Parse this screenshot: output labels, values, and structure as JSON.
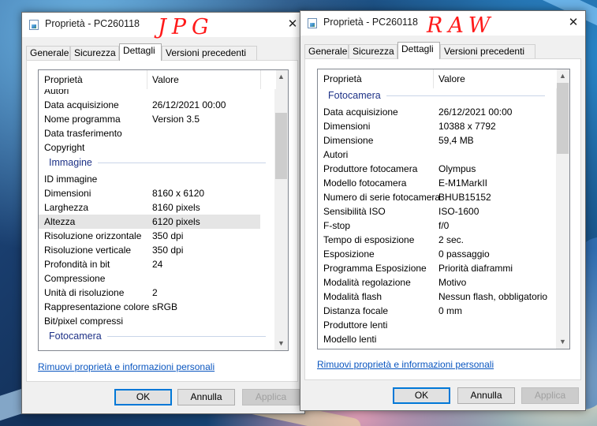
{
  "tabs": [
    "Generale",
    "Sicurezza",
    "Dettagli",
    "Versioni precedenti"
  ],
  "columns": {
    "property": "Proprietà",
    "value": "Valore"
  },
  "buttons": {
    "ok": "OK",
    "cancel": "Annulla",
    "apply": "Applica"
  },
  "remove_link": "Rimuovi proprietà e informazioni personali",
  "left": {
    "title": "Proprietà - PC260118",
    "annotation": "JPG",
    "rows": [
      {
        "prop": "Autori",
        "val": ""
      },
      {
        "prop": "Data acquisizione",
        "val": "26/12/2021 00:00"
      },
      {
        "prop": "Nome programma",
        "val": "Version 3.5"
      },
      {
        "prop": "Data trasferimento",
        "val": ""
      },
      {
        "prop": "Copyright",
        "val": ""
      },
      {
        "group": "Immagine"
      },
      {
        "prop": "ID immagine",
        "val": ""
      },
      {
        "prop": "Dimensioni",
        "val": "8160 x 6120"
      },
      {
        "prop": "Larghezza",
        "val": "8160 pixels"
      },
      {
        "prop": "Altezza",
        "val": "6120 pixels",
        "selected": true
      },
      {
        "prop": "Risoluzione orizzontale",
        "val": "350 dpi"
      },
      {
        "prop": "Risoluzione verticale",
        "val": "350 dpi"
      },
      {
        "prop": "Profondità in bit",
        "val": "24"
      },
      {
        "prop": "Compressione",
        "val": ""
      },
      {
        "prop": "Unità di risoluzione",
        "val": "2"
      },
      {
        "prop": "Rappresentazione colore",
        "val": "sRGB"
      },
      {
        "prop": "Bit/pixel compressi",
        "val": ""
      },
      {
        "group": "Fotocamera"
      }
    ]
  },
  "right": {
    "title": "Proprietà - PC260118",
    "annotation": "RAW",
    "rows": [
      {
        "group": "Fotocamera"
      },
      {
        "prop": "Data acquisizione",
        "val": "26/12/2021 00:00"
      },
      {
        "prop": "Dimensioni",
        "val": "10388 x 7792"
      },
      {
        "prop": "Dimensione",
        "val": "59,4 MB"
      },
      {
        "prop": "Autori",
        "val": ""
      },
      {
        "prop": "Produttore fotocamera",
        "val": "Olympus"
      },
      {
        "prop": "Modello fotocamera",
        "val": "E-M1MarkII"
      },
      {
        "prop": "Numero di serie fotocamera",
        "val": "BHUB15152"
      },
      {
        "prop": "Sensibilità ISO",
        "val": "ISO-1600"
      },
      {
        "prop": "F-stop",
        "val": "f/0"
      },
      {
        "prop": "Tempo di esposizione",
        "val": "2 sec."
      },
      {
        "prop": "Esposizione",
        "val": "0 passaggio"
      },
      {
        "prop": "Programma Esposizione",
        "val": "Priorità diaframmi"
      },
      {
        "prop": "Modalità regolazione",
        "val": "Motivo"
      },
      {
        "prop": "Modalità flash",
        "val": "Nessun flash, obbligatorio"
      },
      {
        "prop": "Distanza focale",
        "val": "0 mm"
      },
      {
        "prop": "Produttore lenti",
        "val": ""
      },
      {
        "prop": "Modello lenti",
        "val": ""
      }
    ]
  },
  "colors": {
    "link": "#0a56c0",
    "group_header": "#1e3287",
    "selected_row": "#e5e5e5",
    "annotation": "#ff1a1a"
  }
}
